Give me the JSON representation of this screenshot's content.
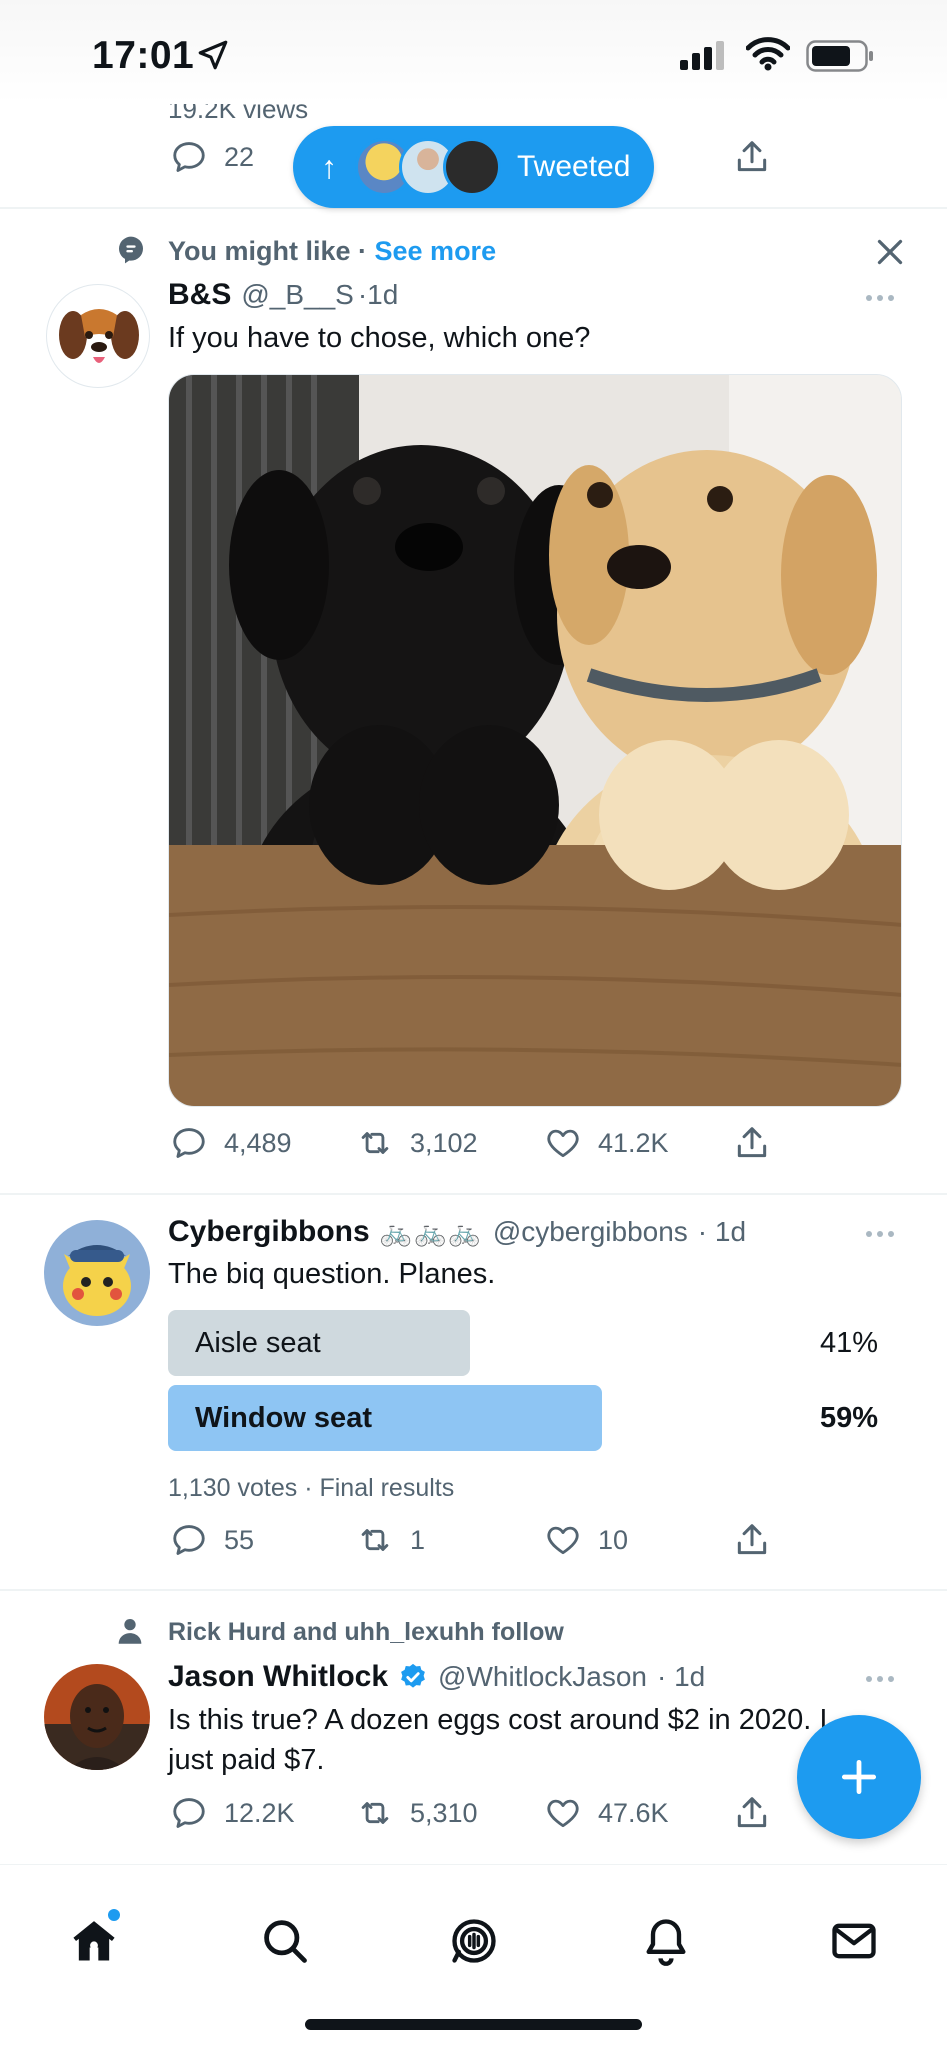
{
  "status_bar": {
    "time": "17:01"
  },
  "colors": {
    "accent": "#1d9bf0",
    "text_primary": "#0f1419",
    "text_secondary": "#536471",
    "poll_winner": "#8ec5f3",
    "poll_loser": "#cfd9de",
    "divider": "#eff3f4"
  },
  "icons": [
    "location-arrow-icon",
    "signal-icon",
    "wifi-icon",
    "battery-icon",
    "reply-icon",
    "retweet-icon",
    "like-icon",
    "share-icon",
    "topic-icon",
    "close-icon",
    "more-icon",
    "person-icon",
    "verified-icon",
    "home-icon",
    "search-icon",
    "spaces-icon",
    "notifications-icon",
    "messages-icon",
    "compose-icon"
  ],
  "new_tweets_pill": {
    "label": "Tweeted",
    "arrow": "↑"
  },
  "tweet_0": {
    "views": "19.2K views",
    "replies": "22"
  },
  "tweet_1": {
    "context": "You might like",
    "separator": " · ",
    "see_more": "See more",
    "name": "B&S",
    "handle": "@_B__S",
    "time": "·1d",
    "text": "If you have to chose, which one?",
    "replies": "4,489",
    "retweets": "3,102",
    "likes": "41.2K"
  },
  "tweet_2": {
    "name": "Cybergibbons",
    "name_emoji": "🚲🚲🚲",
    "handle": "@cybergibbons",
    "time": "· 1d",
    "text": "The biq question. Planes.",
    "poll": {
      "options": [
        {
          "label": "Aisle seat",
          "percent": "41%",
          "value": 41
        },
        {
          "label": "Window seat",
          "percent": "59%",
          "value": 59,
          "winner": true
        }
      ],
      "summary": "1,130 votes · Final results"
    },
    "replies": "55",
    "retweets": "1",
    "likes": "10"
  },
  "tweet_3": {
    "context": "Rick Hurd and uhh_lexuhh follow",
    "name": "Jason Whitlock",
    "handle": "@WhitlockJason",
    "time": "· 1d",
    "text": "Is this true? A dozen eggs cost around $2 in 2020. I just paid $7.",
    "replies": "12.2K",
    "retweets": "5,310",
    "likes": "47.6K"
  }
}
